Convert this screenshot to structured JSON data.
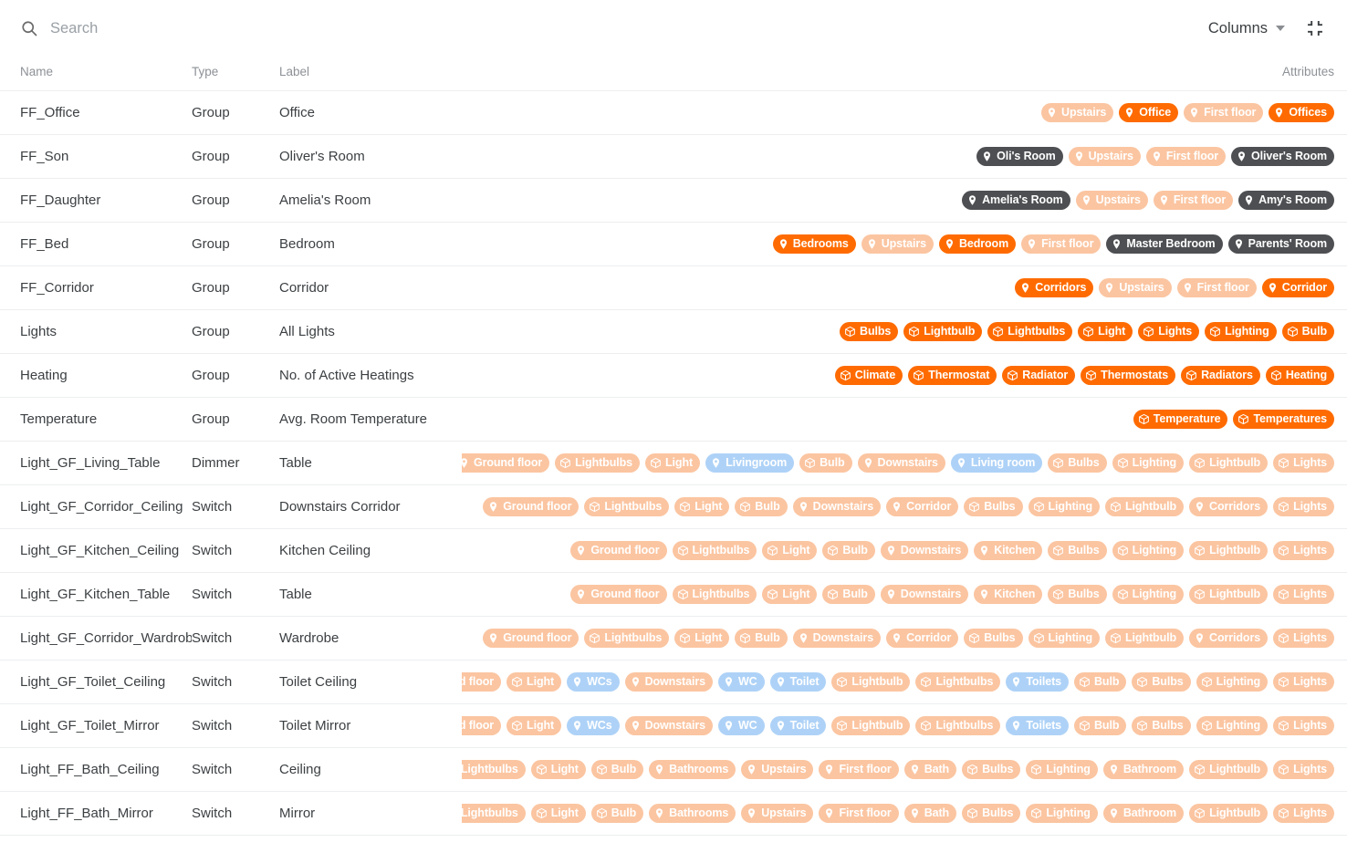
{
  "toolbar": {
    "search_placeholder": "Search",
    "search_value": "",
    "columns_label": "Columns",
    "search_icon": "search-icon",
    "caret_icon": "chevron-down-icon",
    "collapse_icon": "collapse-icon"
  },
  "colors": {
    "chip_faded": "#fbc5a1",
    "chip_solid": "#ff6b00",
    "chip_dark": "#4d4f52",
    "chip_blue": "#aed2f7",
    "text": "#3c4043",
    "header_text": "#8d9196",
    "row_divider": "#eceef0"
  },
  "table": {
    "columns": [
      "Name",
      "Type",
      "Label",
      "Attributes"
    ],
    "rows": [
      {
        "name": "FF_Office",
        "type": "Group",
        "label": "Office",
        "attributes": [
          {
            "text": "Upstairs",
            "tone": "faded",
            "icon": "location-pin-icon"
          },
          {
            "text": "Office",
            "tone": "solid",
            "icon": "location-pin-icon"
          },
          {
            "text": "First floor",
            "tone": "faded",
            "icon": "location-pin-icon"
          },
          {
            "text": "Offices",
            "tone": "solid",
            "icon": "location-pin-icon"
          }
        ]
      },
      {
        "name": "FF_Son",
        "type": "Group",
        "label": "Oliver's Room",
        "attributes": [
          {
            "text": "Oli's Room",
            "tone": "dark",
            "icon": "location-pin-icon"
          },
          {
            "text": "Upstairs",
            "tone": "faded",
            "icon": "location-pin-icon"
          },
          {
            "text": "First floor",
            "tone": "faded",
            "icon": "location-pin-icon"
          },
          {
            "text": "Oliver's Room",
            "tone": "dark",
            "icon": "location-pin-icon"
          }
        ]
      },
      {
        "name": "FF_Daughter",
        "type": "Group",
        "label": "Amelia's Room",
        "attributes": [
          {
            "text": "Amelia's Room",
            "tone": "dark",
            "icon": "location-pin-icon"
          },
          {
            "text": "Upstairs",
            "tone": "faded",
            "icon": "location-pin-icon"
          },
          {
            "text": "First floor",
            "tone": "faded",
            "icon": "location-pin-icon"
          },
          {
            "text": "Amy's Room",
            "tone": "dark",
            "icon": "location-pin-icon"
          }
        ]
      },
      {
        "name": "FF_Bed",
        "type": "Group",
        "label": "Bedroom",
        "attributes": [
          {
            "text": "Bedrooms",
            "tone": "solid",
            "icon": "location-pin-icon"
          },
          {
            "text": "Upstairs",
            "tone": "faded",
            "icon": "location-pin-icon"
          },
          {
            "text": "Bedroom",
            "tone": "solid",
            "icon": "location-pin-icon"
          },
          {
            "text": "First floor",
            "tone": "faded",
            "icon": "location-pin-icon"
          },
          {
            "text": "Master Bedroom",
            "tone": "dark",
            "icon": "location-pin-icon"
          },
          {
            "text": "Parents' Room",
            "tone": "dark",
            "icon": "location-pin-icon"
          }
        ]
      },
      {
        "name": "FF_Corridor",
        "type": "Group",
        "label": "Corridor",
        "attributes": [
          {
            "text": "Corridors",
            "tone": "solid",
            "icon": "location-pin-icon"
          },
          {
            "text": "Upstairs",
            "tone": "faded",
            "icon": "location-pin-icon"
          },
          {
            "text": "First floor",
            "tone": "faded",
            "icon": "location-pin-icon"
          },
          {
            "text": "Corridor",
            "tone": "solid",
            "icon": "location-pin-icon"
          }
        ]
      },
      {
        "name": "Lights",
        "type": "Group",
        "label": "All Lights",
        "attributes": [
          {
            "text": "Bulbs",
            "tone": "solid",
            "icon": "cube-icon"
          },
          {
            "text": "Lightbulb",
            "tone": "solid",
            "icon": "cube-icon"
          },
          {
            "text": "Lightbulbs",
            "tone": "solid",
            "icon": "cube-icon"
          },
          {
            "text": "Light",
            "tone": "solid",
            "icon": "cube-icon"
          },
          {
            "text": "Lights",
            "tone": "solid",
            "icon": "cube-icon"
          },
          {
            "text": "Lighting",
            "tone": "solid",
            "icon": "cube-icon"
          },
          {
            "text": "Bulb",
            "tone": "solid",
            "icon": "cube-icon"
          }
        ]
      },
      {
        "name": "Heating",
        "type": "Group",
        "label": "No. of Active Heatings",
        "attributes": [
          {
            "text": "Climate",
            "tone": "solid",
            "icon": "cube-icon"
          },
          {
            "text": "Thermostat",
            "tone": "solid",
            "icon": "cube-icon"
          },
          {
            "text": "Radiator",
            "tone": "solid",
            "icon": "cube-icon"
          },
          {
            "text": "Thermostats",
            "tone": "solid",
            "icon": "cube-icon"
          },
          {
            "text": "Radiators",
            "tone": "solid",
            "icon": "cube-icon"
          },
          {
            "text": "Heating",
            "tone": "solid",
            "icon": "cube-icon"
          }
        ]
      },
      {
        "name": "Temperature",
        "type": "Group",
        "label": "Avg. Room Temperature",
        "attributes": [
          {
            "text": "Temperature",
            "tone": "solid",
            "icon": "cube-icon"
          },
          {
            "text": "Temperatures",
            "tone": "solid",
            "icon": "cube-icon"
          }
        ]
      },
      {
        "name": "Light_GF_Living_Table",
        "type": "Dimmer",
        "label": "Table",
        "attributes": [
          {
            "text": "Ground floor",
            "tone": "faded",
            "icon": "location-pin-icon"
          },
          {
            "text": "Lightbulbs",
            "tone": "faded",
            "icon": "cube-icon"
          },
          {
            "text": "Light",
            "tone": "faded",
            "icon": "cube-icon"
          },
          {
            "text": "Livingroom",
            "tone": "blue",
            "icon": "location-pin-icon"
          },
          {
            "text": "Bulb",
            "tone": "faded",
            "icon": "cube-icon"
          },
          {
            "text": "Downstairs",
            "tone": "faded",
            "icon": "location-pin-icon"
          },
          {
            "text": "Living room",
            "tone": "blue",
            "icon": "location-pin-icon"
          },
          {
            "text": "Bulbs",
            "tone": "faded",
            "icon": "cube-icon"
          },
          {
            "text": "Lighting",
            "tone": "faded",
            "icon": "cube-icon"
          },
          {
            "text": "Lightbulb",
            "tone": "faded",
            "icon": "cube-icon"
          },
          {
            "text": "Lights",
            "tone": "faded",
            "icon": "cube-icon"
          }
        ]
      },
      {
        "name": "Light_GF_Corridor_Ceiling",
        "type": "Switch",
        "label": "Downstairs Corridor",
        "attributes": [
          {
            "text": "Ground floor",
            "tone": "faded",
            "icon": "location-pin-icon"
          },
          {
            "text": "Lightbulbs",
            "tone": "faded",
            "icon": "cube-icon"
          },
          {
            "text": "Light",
            "tone": "faded",
            "icon": "cube-icon"
          },
          {
            "text": "Bulb",
            "tone": "faded",
            "icon": "cube-icon"
          },
          {
            "text": "Downstairs",
            "tone": "faded",
            "icon": "location-pin-icon"
          },
          {
            "text": "Corridor",
            "tone": "faded",
            "icon": "location-pin-icon"
          },
          {
            "text": "Bulbs",
            "tone": "faded",
            "icon": "cube-icon"
          },
          {
            "text": "Lighting",
            "tone": "faded",
            "icon": "cube-icon"
          },
          {
            "text": "Lightbulb",
            "tone": "faded",
            "icon": "cube-icon"
          },
          {
            "text": "Corridors",
            "tone": "faded",
            "icon": "location-pin-icon"
          },
          {
            "text": "Lights",
            "tone": "faded",
            "icon": "cube-icon"
          }
        ]
      },
      {
        "name": "Light_GF_Kitchen_Ceiling",
        "type": "Switch",
        "label": "Kitchen Ceiling",
        "attributes": [
          {
            "text": "Ground floor",
            "tone": "faded",
            "icon": "location-pin-icon"
          },
          {
            "text": "Lightbulbs",
            "tone": "faded",
            "icon": "cube-icon"
          },
          {
            "text": "Light",
            "tone": "faded",
            "icon": "cube-icon"
          },
          {
            "text": "Bulb",
            "tone": "faded",
            "icon": "cube-icon"
          },
          {
            "text": "Downstairs",
            "tone": "faded",
            "icon": "location-pin-icon"
          },
          {
            "text": "Kitchen",
            "tone": "faded",
            "icon": "location-pin-icon"
          },
          {
            "text": "Bulbs",
            "tone": "faded",
            "icon": "cube-icon"
          },
          {
            "text": "Lighting",
            "tone": "faded",
            "icon": "cube-icon"
          },
          {
            "text": "Lightbulb",
            "tone": "faded",
            "icon": "cube-icon"
          },
          {
            "text": "Lights",
            "tone": "faded",
            "icon": "cube-icon"
          }
        ]
      },
      {
        "name": "Light_GF_Kitchen_Table",
        "type": "Switch",
        "label": "Table",
        "attributes": [
          {
            "text": "Ground floor",
            "tone": "faded",
            "icon": "location-pin-icon"
          },
          {
            "text": "Lightbulbs",
            "tone": "faded",
            "icon": "cube-icon"
          },
          {
            "text": "Light",
            "tone": "faded",
            "icon": "cube-icon"
          },
          {
            "text": "Bulb",
            "tone": "faded",
            "icon": "cube-icon"
          },
          {
            "text": "Downstairs",
            "tone": "faded",
            "icon": "location-pin-icon"
          },
          {
            "text": "Kitchen",
            "tone": "faded",
            "icon": "location-pin-icon"
          },
          {
            "text": "Bulbs",
            "tone": "faded",
            "icon": "cube-icon"
          },
          {
            "text": "Lighting",
            "tone": "faded",
            "icon": "cube-icon"
          },
          {
            "text": "Lightbulb",
            "tone": "faded",
            "icon": "cube-icon"
          },
          {
            "text": "Lights",
            "tone": "faded",
            "icon": "cube-icon"
          }
        ]
      },
      {
        "name": "Light_GF_Corridor_Wardrobe",
        "type": "Switch",
        "label": "Wardrobe",
        "attributes": [
          {
            "text": "Ground floor",
            "tone": "faded",
            "icon": "location-pin-icon"
          },
          {
            "text": "Lightbulbs",
            "tone": "faded",
            "icon": "cube-icon"
          },
          {
            "text": "Light",
            "tone": "faded",
            "icon": "cube-icon"
          },
          {
            "text": "Bulb",
            "tone": "faded",
            "icon": "cube-icon"
          },
          {
            "text": "Downstairs",
            "tone": "faded",
            "icon": "location-pin-icon"
          },
          {
            "text": "Corridor",
            "tone": "faded",
            "icon": "location-pin-icon"
          },
          {
            "text": "Bulbs",
            "tone": "faded",
            "icon": "cube-icon"
          },
          {
            "text": "Lighting",
            "tone": "faded",
            "icon": "cube-icon"
          },
          {
            "text": "Lightbulb",
            "tone": "faded",
            "icon": "cube-icon"
          },
          {
            "text": "Corridors",
            "tone": "faded",
            "icon": "location-pin-icon"
          },
          {
            "text": "Lights",
            "tone": "faded",
            "icon": "cube-icon"
          }
        ]
      },
      {
        "name": "Light_GF_Toilet_Ceiling",
        "type": "Switch",
        "label": "Toilet Ceiling",
        "attributes": [
          {
            "text": "Ground floor",
            "tone": "faded",
            "icon": "location-pin-icon"
          },
          {
            "text": "Light",
            "tone": "faded",
            "icon": "cube-icon"
          },
          {
            "text": "WCs",
            "tone": "blue",
            "icon": "location-pin-icon"
          },
          {
            "text": "Downstairs",
            "tone": "faded",
            "icon": "location-pin-icon"
          },
          {
            "text": "WC",
            "tone": "blue",
            "icon": "location-pin-icon"
          },
          {
            "text": "Toilet",
            "tone": "blue",
            "icon": "location-pin-icon"
          },
          {
            "text": "Lightbulb",
            "tone": "faded",
            "icon": "cube-icon"
          },
          {
            "text": "Lightbulbs",
            "tone": "faded",
            "icon": "cube-icon"
          },
          {
            "text": "Toilets",
            "tone": "blue",
            "icon": "location-pin-icon"
          },
          {
            "text": "Bulb",
            "tone": "faded",
            "icon": "cube-icon"
          },
          {
            "text": "Bulbs",
            "tone": "faded",
            "icon": "cube-icon"
          },
          {
            "text": "Lighting",
            "tone": "faded",
            "icon": "cube-icon"
          },
          {
            "text": "Lights",
            "tone": "faded",
            "icon": "cube-icon"
          }
        ]
      },
      {
        "name": "Light_GF_Toilet_Mirror",
        "type": "Switch",
        "label": "Toilet Mirror",
        "attributes": [
          {
            "text": "Ground floor",
            "tone": "faded",
            "icon": "location-pin-icon"
          },
          {
            "text": "Light",
            "tone": "faded",
            "icon": "cube-icon"
          },
          {
            "text": "WCs",
            "tone": "blue",
            "icon": "location-pin-icon"
          },
          {
            "text": "Downstairs",
            "tone": "faded",
            "icon": "location-pin-icon"
          },
          {
            "text": "WC",
            "tone": "blue",
            "icon": "location-pin-icon"
          },
          {
            "text": "Toilet",
            "tone": "blue",
            "icon": "location-pin-icon"
          },
          {
            "text": "Lightbulb",
            "tone": "faded",
            "icon": "cube-icon"
          },
          {
            "text": "Lightbulbs",
            "tone": "faded",
            "icon": "cube-icon"
          },
          {
            "text": "Toilets",
            "tone": "blue",
            "icon": "location-pin-icon"
          },
          {
            "text": "Bulb",
            "tone": "faded",
            "icon": "cube-icon"
          },
          {
            "text": "Bulbs",
            "tone": "faded",
            "icon": "cube-icon"
          },
          {
            "text": "Lighting",
            "tone": "faded",
            "icon": "cube-icon"
          },
          {
            "text": "Lights",
            "tone": "faded",
            "icon": "cube-icon"
          }
        ]
      },
      {
        "name": "Light_FF_Bath_Ceiling",
        "type": "Switch",
        "label": "Ceiling",
        "attributes": [
          {
            "text": "Lightbulbs",
            "tone": "faded",
            "icon": "cube-icon"
          },
          {
            "text": "Light",
            "tone": "faded",
            "icon": "cube-icon"
          },
          {
            "text": "Bulb",
            "tone": "faded",
            "icon": "cube-icon"
          },
          {
            "text": "Bathrooms",
            "tone": "faded",
            "icon": "location-pin-icon"
          },
          {
            "text": "Upstairs",
            "tone": "faded",
            "icon": "location-pin-icon"
          },
          {
            "text": "First floor",
            "tone": "faded",
            "icon": "location-pin-icon"
          },
          {
            "text": "Bath",
            "tone": "faded",
            "icon": "location-pin-icon"
          },
          {
            "text": "Bulbs",
            "tone": "faded",
            "icon": "cube-icon"
          },
          {
            "text": "Lighting",
            "tone": "faded",
            "icon": "cube-icon"
          },
          {
            "text": "Bathroom",
            "tone": "faded",
            "icon": "location-pin-icon"
          },
          {
            "text": "Lightbulb",
            "tone": "faded",
            "icon": "cube-icon"
          },
          {
            "text": "Lights",
            "tone": "faded",
            "icon": "cube-icon"
          }
        ]
      },
      {
        "name": "Light_FF_Bath_Mirror",
        "type": "Switch",
        "label": "Mirror",
        "attributes": [
          {
            "text": "Lightbulbs",
            "tone": "faded",
            "icon": "cube-icon"
          },
          {
            "text": "Light",
            "tone": "faded",
            "icon": "cube-icon"
          },
          {
            "text": "Bulb",
            "tone": "faded",
            "icon": "cube-icon"
          },
          {
            "text": "Bathrooms",
            "tone": "faded",
            "icon": "location-pin-icon"
          },
          {
            "text": "Upstairs",
            "tone": "faded",
            "icon": "location-pin-icon"
          },
          {
            "text": "First floor",
            "tone": "faded",
            "icon": "location-pin-icon"
          },
          {
            "text": "Bath",
            "tone": "faded",
            "icon": "location-pin-icon"
          },
          {
            "text": "Bulbs",
            "tone": "faded",
            "icon": "cube-icon"
          },
          {
            "text": "Lighting",
            "tone": "faded",
            "icon": "cube-icon"
          },
          {
            "text": "Bathroom",
            "tone": "faded",
            "icon": "location-pin-icon"
          },
          {
            "text": "Lightbulb",
            "tone": "faded",
            "icon": "cube-icon"
          },
          {
            "text": "Lights",
            "tone": "faded",
            "icon": "cube-icon"
          }
        ]
      }
    ]
  }
}
